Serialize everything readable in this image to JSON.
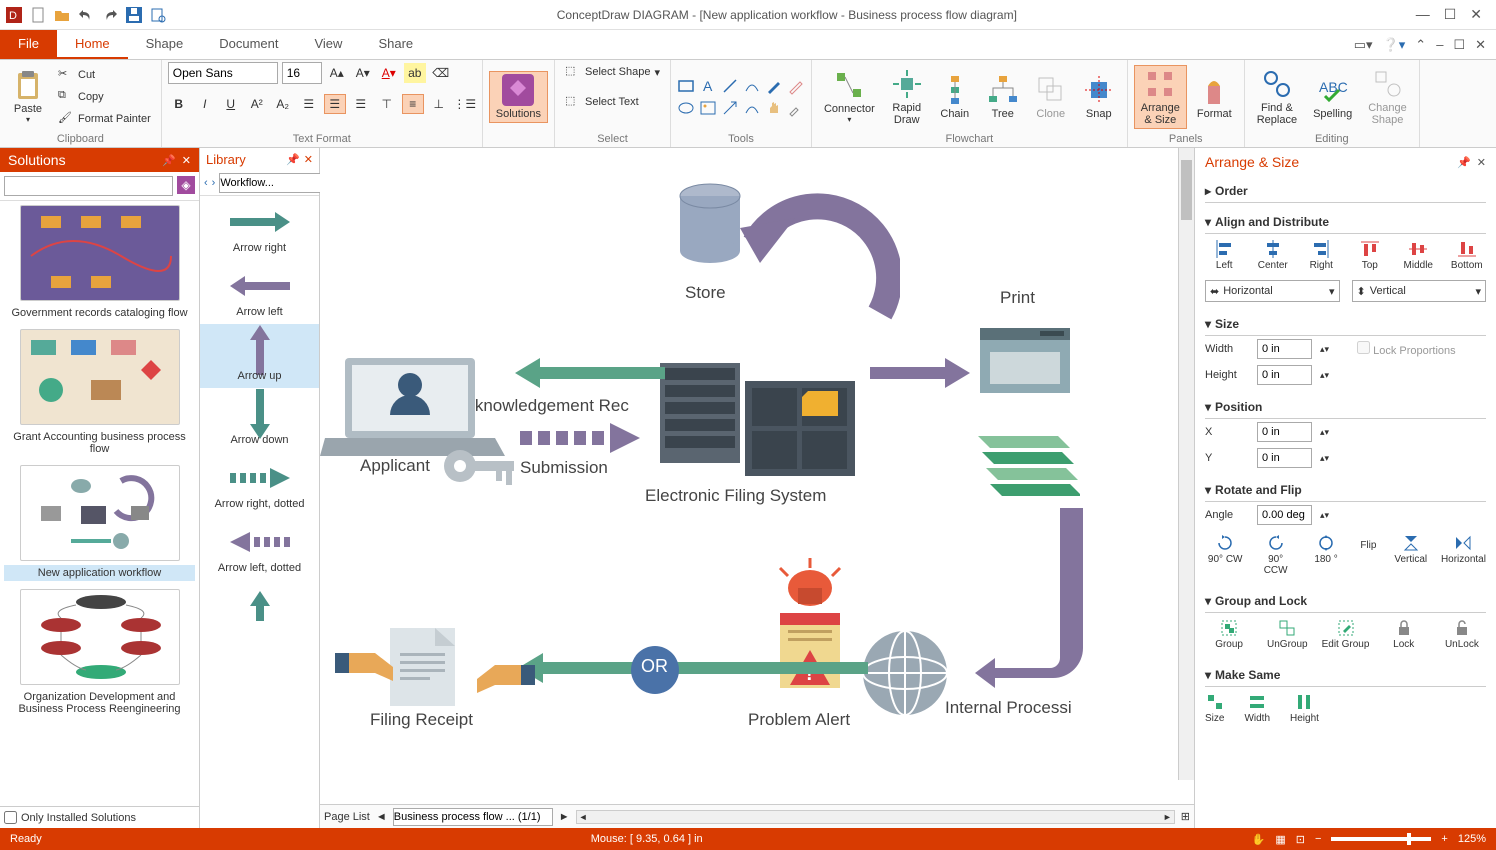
{
  "app": {
    "title": "ConceptDraw DIAGRAM - [New application workflow - Business process flow diagram]"
  },
  "window_controls": {
    "min": "—",
    "max": "☐",
    "close": "✕"
  },
  "menubar": {
    "file": "File",
    "tabs": [
      "Home",
      "Shape",
      "Document",
      "View",
      "Share"
    ],
    "active": 0
  },
  "ribbon": {
    "clipboard": {
      "paste": "Paste",
      "cut": "Cut",
      "copy": "Copy",
      "format_painter": "Format Painter",
      "label": "Clipboard"
    },
    "text_format": {
      "font": "Open Sans",
      "size": "16",
      "label": "Text Format"
    },
    "solutions": {
      "btn": "Solutions"
    },
    "select": {
      "select_shape": "Select Shape",
      "select_text": "Select Text",
      "label": "Select"
    },
    "tools": {
      "label": "Tools"
    },
    "flowchart": {
      "connector": "Connector",
      "rapid_draw": "Rapid\nDraw",
      "chain": "Chain",
      "tree": "Tree",
      "clone": "Clone",
      "snap": "Snap",
      "label": "Flowchart"
    },
    "panels": {
      "arrange": "Arrange\n& Size",
      "format": "Format",
      "label": "Panels"
    },
    "editing": {
      "find": "Find &\nReplace",
      "spelling": "Spelling",
      "change_shape": "Change\nShape",
      "label": "Editing"
    }
  },
  "solutions_panel": {
    "title": "Solutions",
    "search_placeholder": "",
    "items": [
      {
        "caption": "Government records cataloging flow"
      },
      {
        "caption": "Grant Accounting business process flow"
      },
      {
        "caption": "New application workflow",
        "selected": true
      },
      {
        "caption": "Organization Development and Business Process Reengineering"
      }
    ],
    "footer": "Only Installed Solutions"
  },
  "library_panel": {
    "title": "Library",
    "dropdown": "Workflow...",
    "items": [
      {
        "label": "Arrow right",
        "color": "#4a9087"
      },
      {
        "label": "Arrow left",
        "color": "#83749d"
      },
      {
        "label": "Arrow up",
        "color": "#83749d",
        "selected": true
      },
      {
        "label": "Arrow down",
        "color": "#4a9087"
      },
      {
        "label": "Arrow right, dotted",
        "color": "#4a9087"
      },
      {
        "label": "Arrow left, dotted",
        "color": "#83749d"
      }
    ]
  },
  "canvas": {
    "nodes": {
      "store": "Store",
      "print": "Print",
      "applicant": "Applicant",
      "ack": "Acknowledgement Rec",
      "submission": "Submission",
      "efs": "Electronic Filing System",
      "internal": "Internal Processi",
      "problem": "Problem Alert",
      "or": "OR",
      "filing": "Filing Receipt"
    }
  },
  "page_bar": {
    "label": "Page List",
    "current": "Business process flow ... (1/1)"
  },
  "arrange_panel": {
    "title": "Arrange & Size",
    "sections": {
      "order": "Order",
      "align": "Align and Distribute",
      "align_btns": [
        "Left",
        "Center",
        "Right",
        "Top",
        "Middle",
        "Bottom"
      ],
      "horiz": "Horizontal",
      "vert": "Vertical",
      "size": "Size",
      "width": "Width",
      "width_val": "0 in",
      "height": "Height",
      "height_val": "0 in",
      "lock_prop": "Lock Proportions",
      "position": "Position",
      "x": "X",
      "x_val": "0 in",
      "y": "Y",
      "y_val": "0 in",
      "rotate": "Rotate and Flip",
      "angle": "Angle",
      "angle_val": "0.00 deg",
      "rotate_btns": [
        "90° CW",
        "90° CCW",
        "180 °"
      ],
      "flip": "Flip",
      "flip_btns": [
        "Vertical",
        "Horizontal"
      ],
      "group": "Group and Lock",
      "group_btns": [
        "Group",
        "UnGroup",
        "Edit Group",
        "Lock",
        "UnLock"
      ],
      "make_same": "Make Same",
      "make_same_btns": [
        "Size",
        "Width",
        "Height"
      ]
    }
  },
  "statusbar": {
    "ready": "Ready",
    "mouse": "Mouse: [ 9.35, 0.64 ] in",
    "zoom": "125%"
  }
}
